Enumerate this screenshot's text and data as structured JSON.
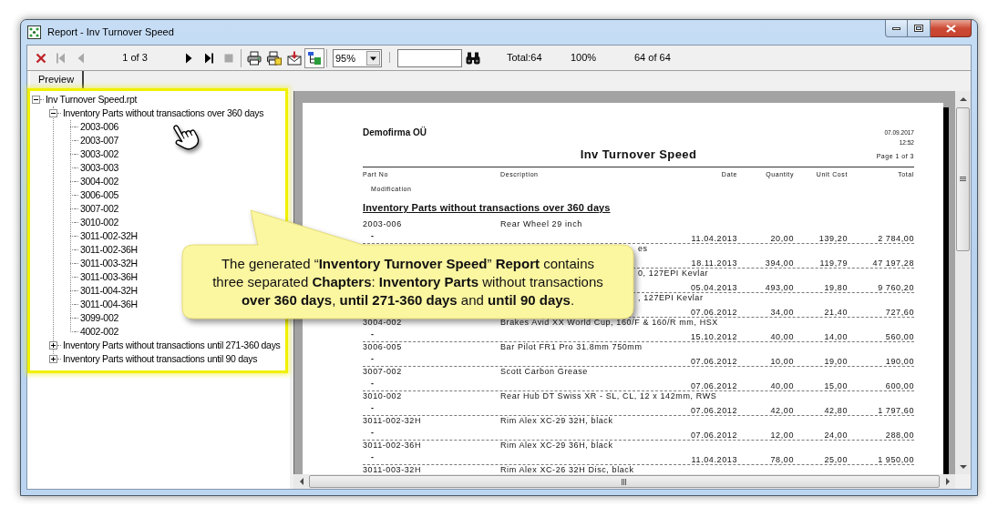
{
  "window": {
    "title": "Report - Inv Turnover Speed"
  },
  "toolbar": {
    "navigation": [
      {
        "kind": "close",
        "disabled": false
      },
      {
        "kind": "first",
        "disabled": true
      },
      {
        "kind": "previous",
        "disabled": true
      }
    ],
    "page": "1 of 3",
    "paging": [
      {
        "kind": "next",
        "disabled": false
      },
      {
        "kind": "last",
        "disabled": false
      },
      {
        "kind": "stop",
        "disabled": true
      }
    ],
    "actions": [
      {
        "kind": "print",
        "pressed": false
      },
      {
        "kind": "print-setup",
        "pressed": false
      },
      {
        "kind": "export",
        "pressed": false
      },
      {
        "kind": "group-tree",
        "pressed": true
      }
    ],
    "zoom": "95%",
    "total": "Total:64",
    "percent": "100%",
    "records": "64 of 64"
  },
  "tabs": [
    {
      "label": "Preview",
      "selected": true
    }
  ],
  "tree": {
    "nodes": [
      {
        "label": "Inv Turnover Speed.rpt",
        "expanded": true,
        "children": [
          {
            "label": "Inventory Parts without transactions over 360 days",
            "expanded": true,
            "children": [
              {
                "label": "2003-006"
              },
              {
                "label": "2003-007"
              },
              {
                "label": "3003-002"
              },
              {
                "label": "3003-003"
              },
              {
                "label": "3004-002"
              },
              {
                "label": "3006-005"
              },
              {
                "label": "3007-002"
              },
              {
                "label": "3010-002"
              },
              {
                "label": "3011-002-32H"
              },
              {
                "label": "3011-002-36H"
              },
              {
                "label": "3011-003-32H"
              },
              {
                "label": "3011-003-36H"
              },
              {
                "label": "3011-004-32H"
              },
              {
                "label": "3011-004-36H"
              },
              {
                "label": "3099-002"
              },
              {
                "label": "4002-002"
              }
            ]
          },
          {
            "label": "Inventory Parts without transactions until 271-360 days",
            "expanded": false
          },
          {
            "label": "Inventory Parts without transactions until 90 days",
            "expanded": false
          }
        ]
      }
    ]
  },
  "report": {
    "company": "Demofirma OÜ",
    "date": "07.09.2017",
    "time": "12:52",
    "page": "Page 1 of 3",
    "title": "Inv Turnover Speed",
    "columns": [
      "Part No",
      "Description",
      "Date",
      "Quantity",
      "Unit Cost",
      "Total"
    ],
    "subheader": "Modification",
    "section": "Inventory Parts without transactions over 360 days",
    "rows": [
      {
        "kind": "item",
        "part_no": "2003-006",
        "description": "Rear Wheel 29 inch",
        "modification": "-",
        "date": "11.04.2013",
        "quantity": "20,00",
        "unit_cost": "139,20",
        "total": "2 784,00"
      },
      {
        "kind": "covered",
        "description": "es",
        "date": "18.11.2013",
        "quantity": "394,00",
        "unit_cost": "119,79",
        "total": "47 197,28"
      },
      {
        "kind": "covered",
        "description": "0, 127EPI Kevlar",
        "date": "05.04.2013",
        "quantity": "493,00",
        "unit_cost": "19,80",
        "total": "9 760,20"
      },
      {
        "kind": "covered",
        "description": ", 127EPI Kevlar",
        "date": "07.06.2012",
        "quantity": "34,00",
        "unit_cost": "21,40",
        "total": "727,60"
      },
      {
        "kind": "item",
        "part_no": "3004-002",
        "description": "Brakes Avid XX World Cup, 160/F & 160/R mm, HSX",
        "modification": "-",
        "date": "15.10.2012",
        "quantity": "40,00",
        "unit_cost": "14,00",
        "total": "560,00"
      },
      {
        "kind": "item",
        "part_no": "3006-005",
        "description": "Bar Pilot FR1 Pro 31.8mm 750mm",
        "modification": "-",
        "date": "07.06.2012",
        "quantity": "10,00",
        "unit_cost": "19,00",
        "total": "190,00"
      },
      {
        "kind": "item",
        "part_no": "3007-002",
        "description": "Scott Carbon Grease",
        "modification": "-",
        "date": "07.06.2012",
        "quantity": "40,00",
        "unit_cost": "15,00",
        "total": "600,00"
      },
      {
        "kind": "item",
        "part_no": "3010-002",
        "description": "Rear Hub DT Swiss XR - SL, CL, 12 x 142mm, RWS",
        "modification": "-",
        "date": "07.06.2012",
        "quantity": "42,00",
        "unit_cost": "42,80",
        "total": "1 797,60"
      },
      {
        "kind": "item",
        "part_no": "3011-002-32H",
        "description": "Rim Alex XC-29 32H, black",
        "modification": "-",
        "date": "07.06.2012",
        "quantity": "12,00",
        "unit_cost": "24,00",
        "total": "288,00"
      },
      {
        "kind": "item",
        "part_no": "3011-002-36H",
        "description": "Rim Alex XC-29 36H, black",
        "modification": "-",
        "date": "11.04.2013",
        "quantity": "78,00",
        "unit_cost": "25,00",
        "total": "1 950,00"
      },
      {
        "kind": "item",
        "part_no": "3011-003-32H",
        "description": "Rim Alex XC-26 32H Disc, black"
      }
    ]
  },
  "callout": {
    "text": "The generated “**Inventory Turnover Speed**” **Report** contains three separated **Chapters**: **Inventory Parts** without transactions **over 360 days**, **until 271-360 days** and **until 90 days**."
  }
}
